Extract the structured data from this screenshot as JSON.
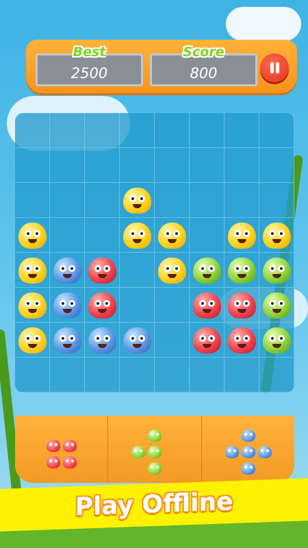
{
  "scores": {
    "best_label": "Best",
    "best_value": "2500",
    "score_label": "Score",
    "score_value": "800"
  },
  "pause": {
    "icon": "pause-icon"
  },
  "board": {
    "cols": 8,
    "rows": 8,
    "cells": [
      [
        "",
        "",
        "",
        "",
        "",
        "",
        "",
        ""
      ],
      [
        "",
        "",
        "",
        "",
        "",
        "",
        "",
        ""
      ],
      [
        "",
        "",
        "",
        "yellow",
        "",
        "",
        "",
        ""
      ],
      [
        "yellow",
        "",
        "",
        "yellow",
        "yellow",
        "",
        "yellow",
        "yellow"
      ],
      [
        "yellow",
        "blue",
        "red",
        "",
        "yellow",
        "green",
        "green",
        "green"
      ],
      [
        "yellow",
        "blue",
        "red",
        "",
        "",
        "red",
        "red",
        "green"
      ],
      [
        "yellow",
        "blue",
        "blue",
        "blue",
        "",
        "red",
        "red",
        "green"
      ],
      [
        "",
        "",
        "",
        "",
        "",
        "",
        "",
        ""
      ]
    ]
  },
  "tray": {
    "pieces": [
      {
        "color": "red",
        "shape": "square-2x2"
      },
      {
        "color": "green",
        "shape": "t-shape"
      },
      {
        "color": "blue",
        "shape": "plus"
      }
    ]
  },
  "banner": {
    "text": "Play Offline"
  },
  "colors": {
    "orange": "#f7941d",
    "yellow": "#ffd21e",
    "blue": "#5a98e6",
    "red": "#f2424e",
    "green": "#8fd33a",
    "banner": "#fff200"
  }
}
